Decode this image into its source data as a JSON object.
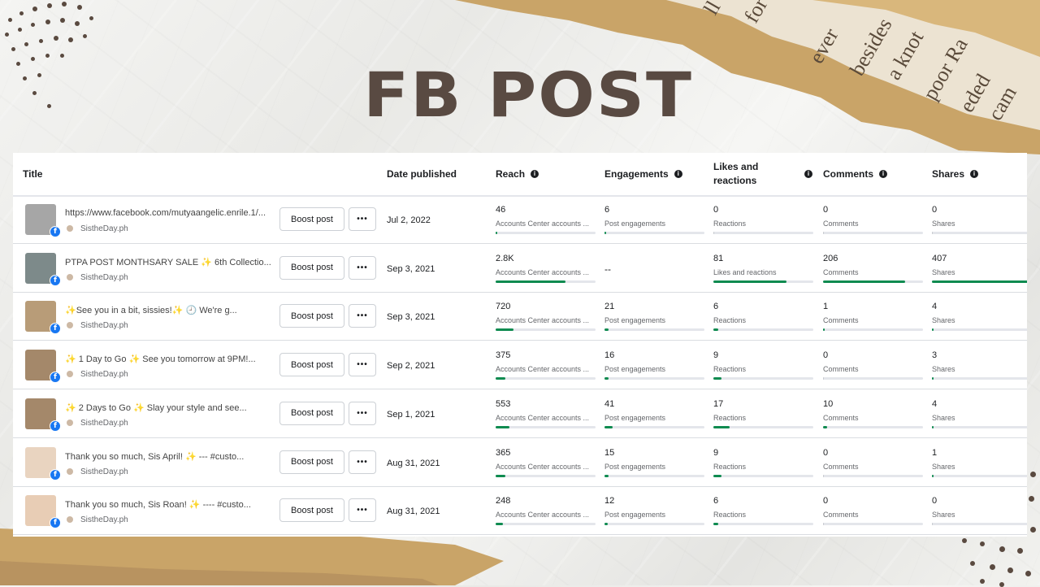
{
  "banner_title": "FB POST",
  "table": {
    "headers": {
      "title": "Title",
      "date": "Date published",
      "reach": "Reach",
      "engagements": "Engagements",
      "likes": "Likes and reactions",
      "comments": "Comments",
      "shares": "Shares"
    },
    "boost_label": "Boost post",
    "more_label": "•••",
    "page_name": "SistheDay.ph",
    "rows": [
      {
        "title": "https://www.facebook.com/mutyaangelic.enrile.1/...",
        "date": "Jul 2, 2022",
        "thumb_color": "#a6a6a6",
        "reach": {
          "value": "46",
          "label": "Accounts Center accounts ...",
          "fill": 0.01
        },
        "engagements": {
          "value": "6",
          "label": "Post engagements",
          "fill": 0.01
        },
        "likes": {
          "value": "0",
          "label": "Reactions",
          "fill": 0
        },
        "comments": {
          "value": "0",
          "label": "Comments",
          "fill": 0
        },
        "shares": {
          "value": "0",
          "label": "Shares",
          "fill": 0
        }
      },
      {
        "title": "PTPA POST MONTHSARY SALE ✨ 6th Collectio...",
        "date": "Sep 3, 2021",
        "thumb_color": "#7d8a8a",
        "reach": {
          "value": "2.8K",
          "label": "Accounts Center accounts ...",
          "fill": 0.7
        },
        "engagements": {
          "value": "--",
          "label": "",
          "fill": null
        },
        "likes": {
          "value": "81",
          "label": "Likes and reactions",
          "fill": 0.73
        },
        "comments": {
          "value": "206",
          "label": "Comments",
          "fill": 0.82
        },
        "shares": {
          "value": "407",
          "label": "Shares",
          "fill": 1.0
        }
      },
      {
        "title": "✨See you in a bit, sissies!✨ 🕘 We're g...",
        "date": "Sep 3, 2021",
        "thumb_color": "#b89c78",
        "reach": {
          "value": "720",
          "label": "Accounts Center accounts ...",
          "fill": 0.18
        },
        "engagements": {
          "value": "21",
          "label": "Post engagements",
          "fill": 0.04
        },
        "likes": {
          "value": "6",
          "label": "Reactions",
          "fill": 0.05
        },
        "comments": {
          "value": "1",
          "label": "Comments",
          "fill": 0.01
        },
        "shares": {
          "value": "4",
          "label": "Shares",
          "fill": 0.01
        }
      },
      {
        "title": "✨ 1 Day to Go ✨ See you tomorrow at 9PM!...",
        "date": "Sep 2, 2021",
        "thumb_color": "#a4886a",
        "reach": {
          "value": "375",
          "label": "Accounts Center accounts ...",
          "fill": 0.1
        },
        "engagements": {
          "value": "16",
          "label": "Post engagements",
          "fill": 0.04
        },
        "likes": {
          "value": "9",
          "label": "Reactions",
          "fill": 0.08
        },
        "comments": {
          "value": "0",
          "label": "Comments",
          "fill": 0
        },
        "shares": {
          "value": "3",
          "label": "Shares",
          "fill": 0.01
        }
      },
      {
        "title": "✨ 2 Days to Go ✨ Slay your style and see...",
        "date": "Sep 1, 2021",
        "thumb_color": "#a4886a",
        "reach": {
          "value": "553",
          "label": "Accounts Center accounts ...",
          "fill": 0.14
        },
        "engagements": {
          "value": "41",
          "label": "Post engagements",
          "fill": 0.08
        },
        "likes": {
          "value": "17",
          "label": "Reactions",
          "fill": 0.16
        },
        "comments": {
          "value": "10",
          "label": "Comments",
          "fill": 0.04
        },
        "shares": {
          "value": "4",
          "label": "Shares",
          "fill": 0.01
        }
      },
      {
        "title": "Thank you so much, Sis April! ✨ --- #custo...",
        "date": "Aug 31, 2021",
        "thumb_color": "#e9d4c0",
        "reach": {
          "value": "365",
          "label": "Accounts Center accounts ...",
          "fill": 0.1
        },
        "engagements": {
          "value": "15",
          "label": "Post engagements",
          "fill": 0.04
        },
        "likes": {
          "value": "9",
          "label": "Reactions",
          "fill": 0.08
        },
        "comments": {
          "value": "0",
          "label": "Comments",
          "fill": 0
        },
        "shares": {
          "value": "1",
          "label": "Shares",
          "fill": 0.01
        }
      },
      {
        "title": "Thank you so much, Sis Roan! ✨ ---- #custo...",
        "date": "Aug 31, 2021",
        "thumb_color": "#e8cdb5",
        "reach": {
          "value": "248",
          "label": "Accounts Center accounts ...",
          "fill": 0.07
        },
        "engagements": {
          "value": "12",
          "label": "Post engagements",
          "fill": 0.03
        },
        "likes": {
          "value": "6",
          "label": "Reactions",
          "fill": 0.05
        },
        "comments": {
          "value": "0",
          "label": "Comments",
          "fill": 0
        },
        "shares": {
          "value": "0",
          "label": "Shares",
          "fill": 0
        }
      }
    ]
  },
  "colors": {
    "title_brown": "#594a42",
    "kraft_paper": "#c9a468",
    "progress_green": "#0f8b50",
    "facebook_blue": "#1877f2"
  }
}
